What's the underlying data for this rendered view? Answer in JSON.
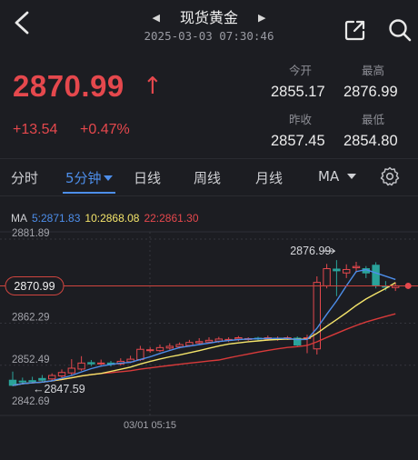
{
  "header": {
    "title": "现货黄金",
    "timestamp": "2025-03-03 07:30:46"
  },
  "quote": {
    "price": "2870.99",
    "change": "+13.54",
    "change_pct": "+0.47%",
    "open_label": "今开",
    "open_value": "2855.17",
    "high_label": "最高",
    "high_value": "2876.99",
    "prev_close_label": "昨收",
    "prev_close_value": "2857.45",
    "low_label": "最低",
    "low_value": "2854.80"
  },
  "tabs": [
    {
      "label": "分时",
      "active": false
    },
    {
      "label": "5分钟",
      "active": true
    },
    {
      "label": "日线",
      "active": false
    },
    {
      "label": "周线",
      "active": false
    },
    {
      "label": "月线",
      "active": false
    },
    {
      "label": "MA",
      "active": false
    }
  ],
  "colors": {
    "up": "#e5484d",
    "down": "#2aa39a",
    "ma5": "#4d8eea",
    "ma10": "#f4e46a",
    "ma22": "#d93a3a",
    "accent": "#4d8eea"
  },
  "chart_data": {
    "type": "candlestick",
    "ma_label": "MA",
    "ma5_text": "5:2871.83",
    "ma10_text": "10:2868.08",
    "ma22_text": "22:2861.30",
    "y_ticks": [
      "2881.89",
      "2862.29",
      "2852.49",
      "2842.69"
    ],
    "current_price_tag": "2870.99",
    "high_marker": "2876.99",
    "low_marker": "2847.59",
    "x_tick": "03/01 05:15",
    "ylim": [
      2842.69,
      2881.89
    ],
    "candles": [
      [
        2849.0,
        2847.8,
        2851.0,
        2847.59
      ],
      [
        2848.8,
        2848.6,
        2849.6,
        2848.0
      ],
      [
        2848.9,
        2848.8,
        2849.8,
        2848.3
      ],
      [
        2849.4,
        2849.0,
        2850.2,
        2848.6
      ],
      [
        2849.3,
        2850.1,
        2850.6,
        2848.9
      ],
      [
        2850.0,
        2850.8,
        2851.5,
        2849.6
      ],
      [
        2850.7,
        2851.8,
        2853.9,
        2850.2
      ],
      [
        2851.6,
        2853.0,
        2854.6,
        2851.2
      ],
      [
        2853.1,
        2852.8,
        2853.7,
        2852.3
      ],
      [
        2852.9,
        2853.0,
        2853.8,
        2852.5
      ],
      [
        2853.0,
        2852.7,
        2853.5,
        2852.2
      ],
      [
        2852.8,
        2853.4,
        2854.1,
        2852.4
      ],
      [
        2853.3,
        2853.9,
        2854.7,
        2853.0
      ],
      [
        2853.8,
        2856.2,
        2857.0,
        2853.5
      ],
      [
        2856.0,
        2856.1,
        2856.7,
        2855.4
      ],
      [
        2855.9,
        2856.6,
        2857.3,
        2855.6
      ],
      [
        2856.5,
        2856.9,
        2857.6,
        2856.1
      ],
      [
        2856.8,
        2857.3,
        2857.8,
        2856.4
      ],
      [
        2857.1,
        2857.8,
        2858.4,
        2856.8
      ],
      [
        2857.7,
        2858.0,
        2858.8,
        2857.2
      ],
      [
        2857.9,
        2858.3,
        2859.0,
        2857.6
      ],
      [
        2858.1,
        2858.6,
        2859.1,
        2857.7
      ],
      [
        2858.4,
        2858.5,
        2859.0,
        2857.9
      ],
      [
        2858.6,
        2858.9,
        2859.3,
        2858.1
      ],
      [
        2858.6,
        2858.7,
        2859.0,
        2858.2
      ],
      [
        2858.8,
        2858.6,
        2859.1,
        2858.3
      ],
      [
        2858.6,
        2858.9,
        2859.4,
        2858.2
      ],
      [
        2858.6,
        2858.7,
        2859.2,
        2858.2
      ],
      [
        2858.8,
        2858.9,
        2859.3,
        2858.4
      ],
      [
        2858.8,
        2857.2,
        2859.2,
        2856.9
      ],
      [
        2858.8,
        2858.9,
        2859.6,
        2855.3
      ],
      [
        2856.3,
        2871.8,
        2873.2,
        2855.0
      ],
      [
        2871.0,
        2875.0,
        2876.1,
        2870.4
      ],
      [
        2874.9,
        2874.5,
        2876.99,
        2868.6
      ],
      [
        2874.0,
        2874.8,
        2876.0,
        2872.8
      ],
      [
        2875.2,
        2875.5,
        2876.6,
        2874.1
      ],
      [
        2875.0,
        2874.0,
        2875.6,
        2872.8
      ],
      [
        2875.8,
        2871.2,
        2876.5,
        2870.4
      ],
      [
        2870.9,
        2870.7,
        2872.1,
        2869.9
      ],
      [
        2870.6,
        2870.99,
        2871.8,
        2869.8
      ]
    ]
  }
}
